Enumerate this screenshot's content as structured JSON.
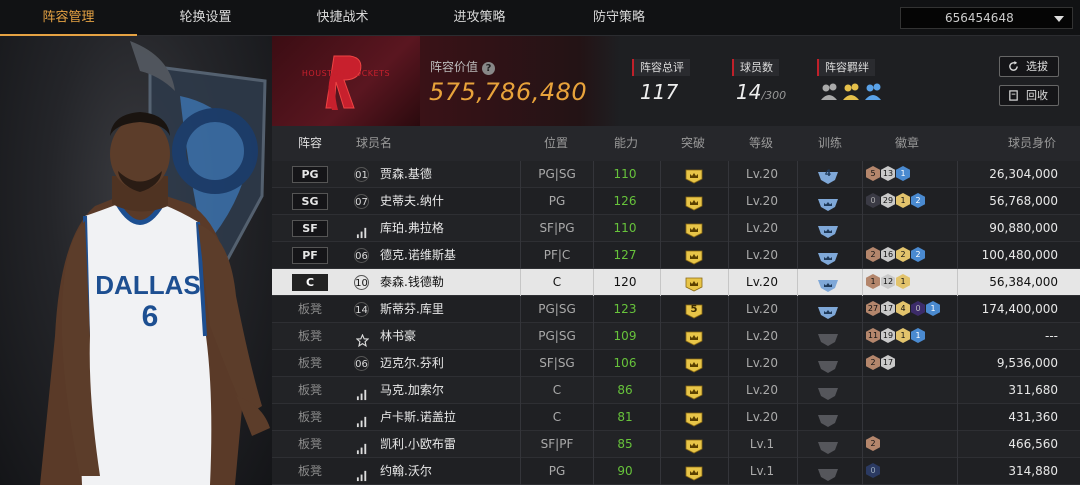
{
  "tabs": [
    {
      "label": "阵容管理",
      "active": true
    },
    {
      "label": "轮换设置",
      "active": false
    },
    {
      "label": "快捷战术",
      "active": false
    },
    {
      "label": "进攻策略",
      "active": false
    },
    {
      "label": "防守策略",
      "active": false
    }
  ],
  "account": {
    "id": "656454648"
  },
  "team": {
    "logo_text": "HOUSTON ROCKETS",
    "value_label": "阵容价值",
    "value": "575,786,480",
    "rating_label": "阵容总评",
    "rating": "117",
    "players_label": "球员数",
    "players_count": "14",
    "players_max": "/300",
    "bond_label": "阵容羁绊"
  },
  "actions": {
    "select": "选拔",
    "recycle": "回收"
  },
  "columns": [
    "阵容",
    "球员名",
    "位置",
    "能力",
    "突破",
    "等级",
    "训练",
    "徽章",
    "球员身价"
  ],
  "rows": [
    {
      "slot": "PG",
      "jersey": "01",
      "name": "贾森.基德",
      "position": "PG|SG",
      "ability": "110",
      "breakthrough": "crown",
      "level": "Lv.20",
      "training": "4",
      "badges": [
        {
          "t": "bronze",
          "v": "5"
        },
        {
          "t": "silver",
          "v": "13"
        },
        {
          "t": "blue",
          "v": "1"
        }
      ],
      "value": "26,304,000"
    },
    {
      "slot": "SG",
      "jersey": "07",
      "name": "史蒂夫.纳什",
      "position": "PG",
      "ability": "126",
      "breakthrough": "crown",
      "level": "Lv.20",
      "training": "",
      "badges": [
        {
          "t": "dark",
          "v": "0"
        },
        {
          "t": "silver",
          "v": "29"
        },
        {
          "t": "gold",
          "v": "1"
        },
        {
          "t": "blue",
          "v": "2"
        }
      ],
      "value": "56,768,000"
    },
    {
      "slot": "SF",
      "jersey": "",
      "name": "库珀.弗拉格",
      "position": "SF|PG",
      "ability": "110",
      "breakthrough": "crown",
      "level": "Lv.20",
      "training": "",
      "badges": [],
      "value": "90,880,000"
    },
    {
      "slot": "PF",
      "jersey": "06",
      "name": "德克.诺维斯基",
      "position": "PF|C",
      "ability": "127",
      "breakthrough": "crown",
      "level": "Lv.20",
      "training": "",
      "badges": [
        {
          "t": "bronze",
          "v": "2"
        },
        {
          "t": "silver",
          "v": "16"
        },
        {
          "t": "gold",
          "v": "2"
        },
        {
          "t": "blue",
          "v": "2"
        }
      ],
      "value": "100,480,000"
    },
    {
      "slot": "C",
      "jersey": "10",
      "name": "泰森.钱德勒",
      "position": "C",
      "ability": "120",
      "breakthrough": "crown",
      "level": "Lv.20",
      "training": "",
      "badges": [
        {
          "t": "bronze",
          "v": "1"
        },
        {
          "t": "silver",
          "v": "12"
        },
        {
          "t": "gold",
          "v": "1"
        }
      ],
      "value": "56,384,000",
      "selected": true
    },
    {
      "slot": "板凳",
      "jersey": "14",
      "name": "斯蒂芬.库里",
      "position": "PG|SG",
      "ability": "123",
      "breakthrough": "5",
      "level": "Lv.20",
      "training": "",
      "badges": [
        {
          "t": "bronze",
          "v": "27"
        },
        {
          "t": "silver",
          "v": "17"
        },
        {
          "t": "gold",
          "v": "4"
        },
        {
          "t": "purple",
          "v": "0"
        },
        {
          "t": "blue",
          "v": "1"
        }
      ],
      "value": "174,400,000"
    },
    {
      "slot": "板凳",
      "jersey": "",
      "name": "林书豪",
      "position": "PG|SG",
      "ability": "109",
      "breakthrough": "crown",
      "level": "Lv.20",
      "training": "",
      "badges": [
        {
          "t": "bronze",
          "v": "11"
        },
        {
          "t": "silver",
          "v": "19"
        },
        {
          "t": "gold",
          "v": "1"
        },
        {
          "t": "blue",
          "v": "1"
        }
      ],
      "value": "---"
    },
    {
      "slot": "板凳",
      "jersey": "06",
      "name": "迈克尔.芬利",
      "position": "SF|SG",
      "ability": "106",
      "breakthrough": "crown",
      "level": "Lv.20",
      "training": "",
      "badges": [
        {
          "t": "bronze",
          "v": "2"
        },
        {
          "t": "silver",
          "v": "17"
        }
      ],
      "value": "9,536,000"
    },
    {
      "slot": "板凳",
      "jersey": "",
      "name": "马克.加索尔",
      "position": "C",
      "ability": "86",
      "breakthrough": "crown",
      "level": "Lv.20",
      "training": "",
      "badges": [],
      "value": "311,680"
    },
    {
      "slot": "板凳",
      "jersey": "",
      "name": "卢卡斯.诺盖拉",
      "position": "C",
      "ability": "81",
      "breakthrough": "crown",
      "level": "Lv.20",
      "training": "",
      "badges": [],
      "value": "431,360"
    },
    {
      "slot": "板凳",
      "jersey": "",
      "name": "凯利.小欧布雷",
      "position": "SF|PF",
      "ability": "85",
      "breakthrough": "crown",
      "level": "Lv.1",
      "training": "",
      "badges": [
        {
          "t": "bronze",
          "v": "2"
        }
      ],
      "value": "466,560"
    },
    {
      "slot": "板凳",
      "jersey": "",
      "name": "约翰.沃尔",
      "position": "PG",
      "ability": "90",
      "breakthrough": "crown",
      "level": "Lv.1",
      "training": "",
      "badges": [
        {
          "t": "navy",
          "v": "0"
        }
      ],
      "value": "314,880"
    }
  ],
  "portrait": {
    "jersey_text": "DALLAS",
    "jersey_number": "6"
  },
  "colors": {
    "accent": "#e5a243",
    "ability_green": "#67c33b",
    "team_red": "#5a1620",
    "training_blue": "#7fa8d8"
  }
}
